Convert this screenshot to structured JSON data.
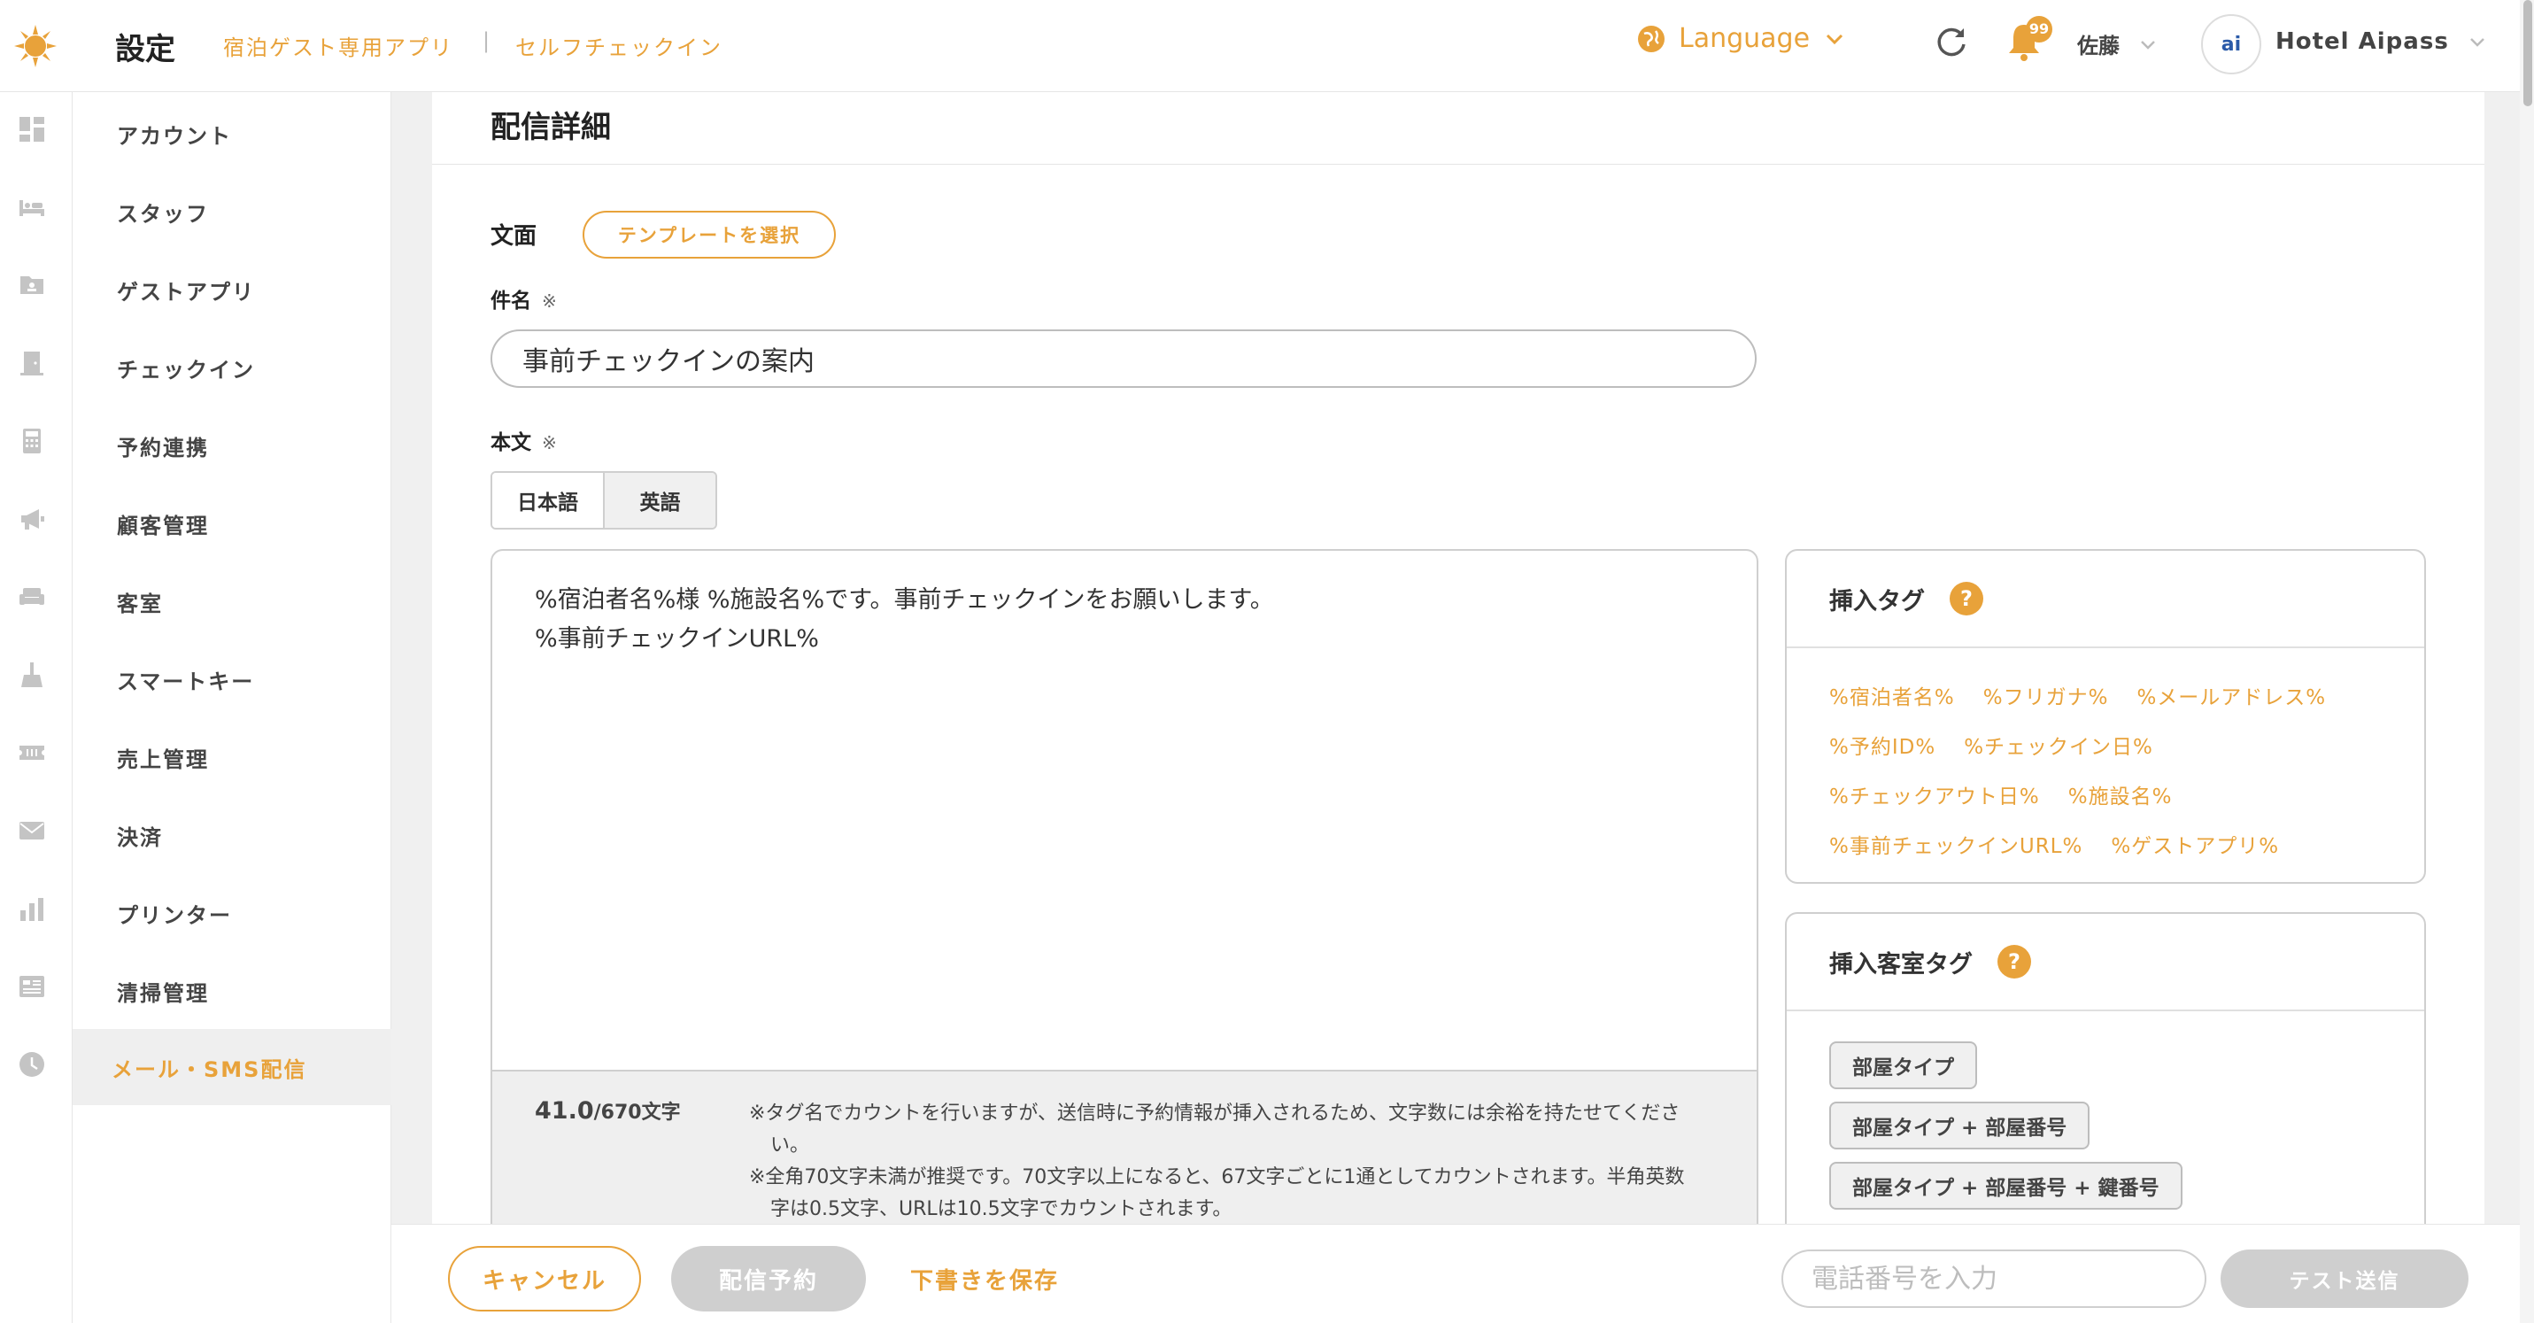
{
  "header": {
    "title": "設定",
    "links": [
      "宿泊ゲスト専用アプリ",
      "セルフチェックイン"
    ],
    "separator": "|",
    "language": "Language",
    "badge_count": "99",
    "user_name": "佐藤",
    "hotel_name": "Hotel Aipass",
    "hotel_logo": "ai"
  },
  "rail_icons": [
    "dashboard-icon",
    "bed-icon",
    "guest-card-icon",
    "door-icon",
    "calculator-icon",
    "megaphone-icon",
    "sofa-icon",
    "broom-icon",
    "ticket-icon",
    "mail-icon",
    "bar-chart-icon",
    "list-card-icon",
    "clock-icon"
  ],
  "sidebar": {
    "items": [
      {
        "label": "アカウント"
      },
      {
        "label": "スタッフ"
      },
      {
        "label": "ゲストアプリ"
      },
      {
        "label": "チェックイン"
      },
      {
        "label": "予約連携"
      },
      {
        "label": "顧客管理"
      },
      {
        "label": "客室"
      },
      {
        "label": "スマートキー"
      },
      {
        "label": "売上管理"
      },
      {
        "label": "決済"
      },
      {
        "label": "プリンター"
      },
      {
        "label": "清掃管理"
      },
      {
        "label": "メール・SMS配信"
      }
    ],
    "active_index": 12
  },
  "main": {
    "title": "配信詳細",
    "text_label": "文面",
    "template_button": "テンプレートを選択",
    "subject_label": "件名",
    "required_mark": "※",
    "subject_value": "事前チェックインの案内",
    "body_label": "本文",
    "tabs": [
      "日本語",
      "英語"
    ],
    "body_text": "%宿泊者名%様 %施設名%です。事前チェックインをお願いします。\n%事前チェックインURL%",
    "char_count": "41.0",
    "char_unit": "/670文字",
    "notes": [
      "※タグ名でカウントを行いますが、送信時に予約情報が挿入されるため、文字数には余裕を持たせてください。",
      "※全角70文字未満が推奨です。70文字以上になると、67文字ごとに1通としてカウントされます。半角英数字は0.5文字、URLは10.5文字でカウントされます。"
    ]
  },
  "insert_tags": {
    "title": "挿入タグ",
    "help": "?",
    "tags": [
      "%宿泊者名%",
      "%フリガナ%",
      "%メールアドレス%",
      "%予約ID%",
      "%チェックイン日%",
      "%チェックアウト日%",
      "%施設名%",
      "%事前チェックインURL%",
      "%ゲストアプリ%"
    ]
  },
  "room_tags": {
    "title": "挿入客室タグ",
    "help": "?",
    "tags": [
      "部屋タイプ",
      "部屋タイプ + 部屋番号",
      "部屋タイプ + 部屋番号 + 鍵番号"
    ]
  },
  "footer": {
    "cancel": "キャンセル",
    "schedule": "配信予約",
    "draft": "下書きを保存",
    "phone_placeholder": "電話番号を入力",
    "test_send": "テスト送信"
  },
  "colors": {
    "accent": "#e8a23a",
    "disabled": "#cfcfcf"
  }
}
